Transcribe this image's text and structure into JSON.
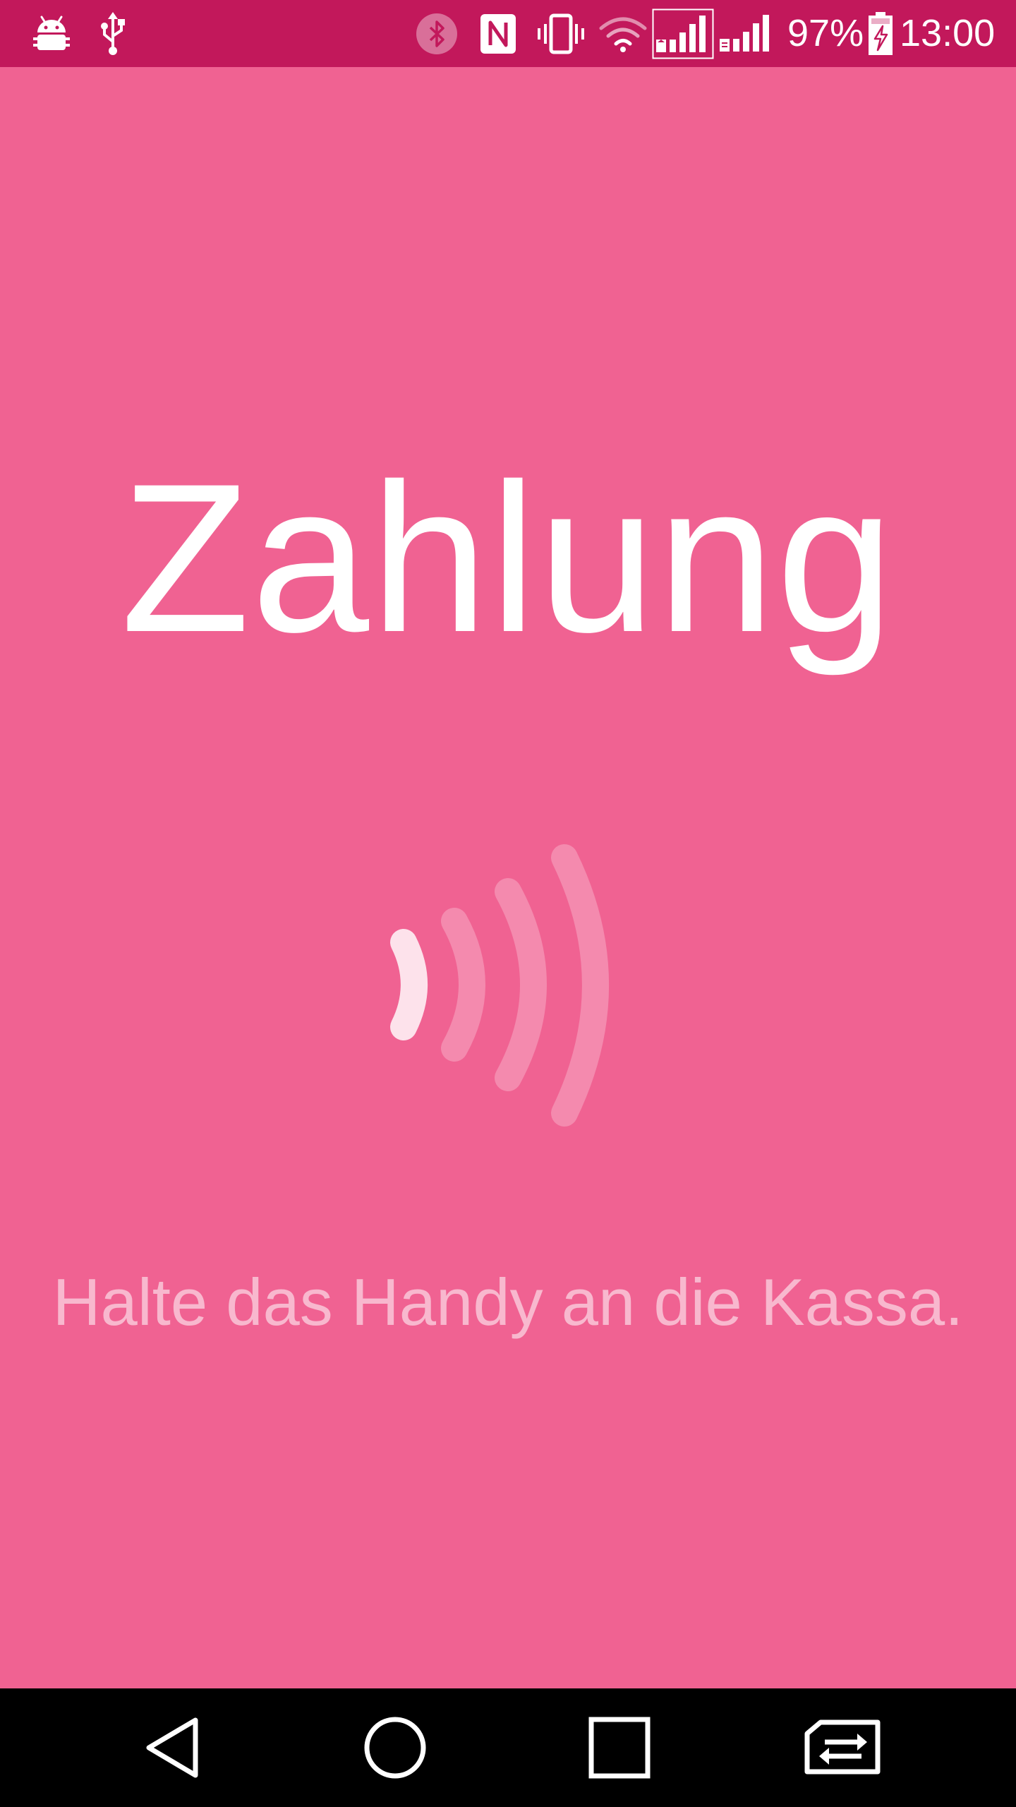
{
  "status_bar": {
    "battery_percent": "97%",
    "time": "13:00",
    "icons": [
      "android-debug-icon",
      "usb-icon",
      "bluetooth-icon",
      "nfc-icon",
      "vibrate-icon",
      "wifi-icon",
      "signal-sim1-icon",
      "signal-sim2-icon",
      "battery-charging-icon"
    ]
  },
  "main": {
    "title": "Zahlung",
    "instruction": "Halte das Handy an die Kassa.",
    "icon": "contactless-payment-icon"
  },
  "nav_bar": {
    "buttons": [
      "back-icon",
      "home-icon",
      "recents-icon",
      "switch-sim-icon"
    ]
  },
  "colors": {
    "status_bar": "#c2185b",
    "background": "#f06292",
    "nav_bar": "#000000"
  }
}
